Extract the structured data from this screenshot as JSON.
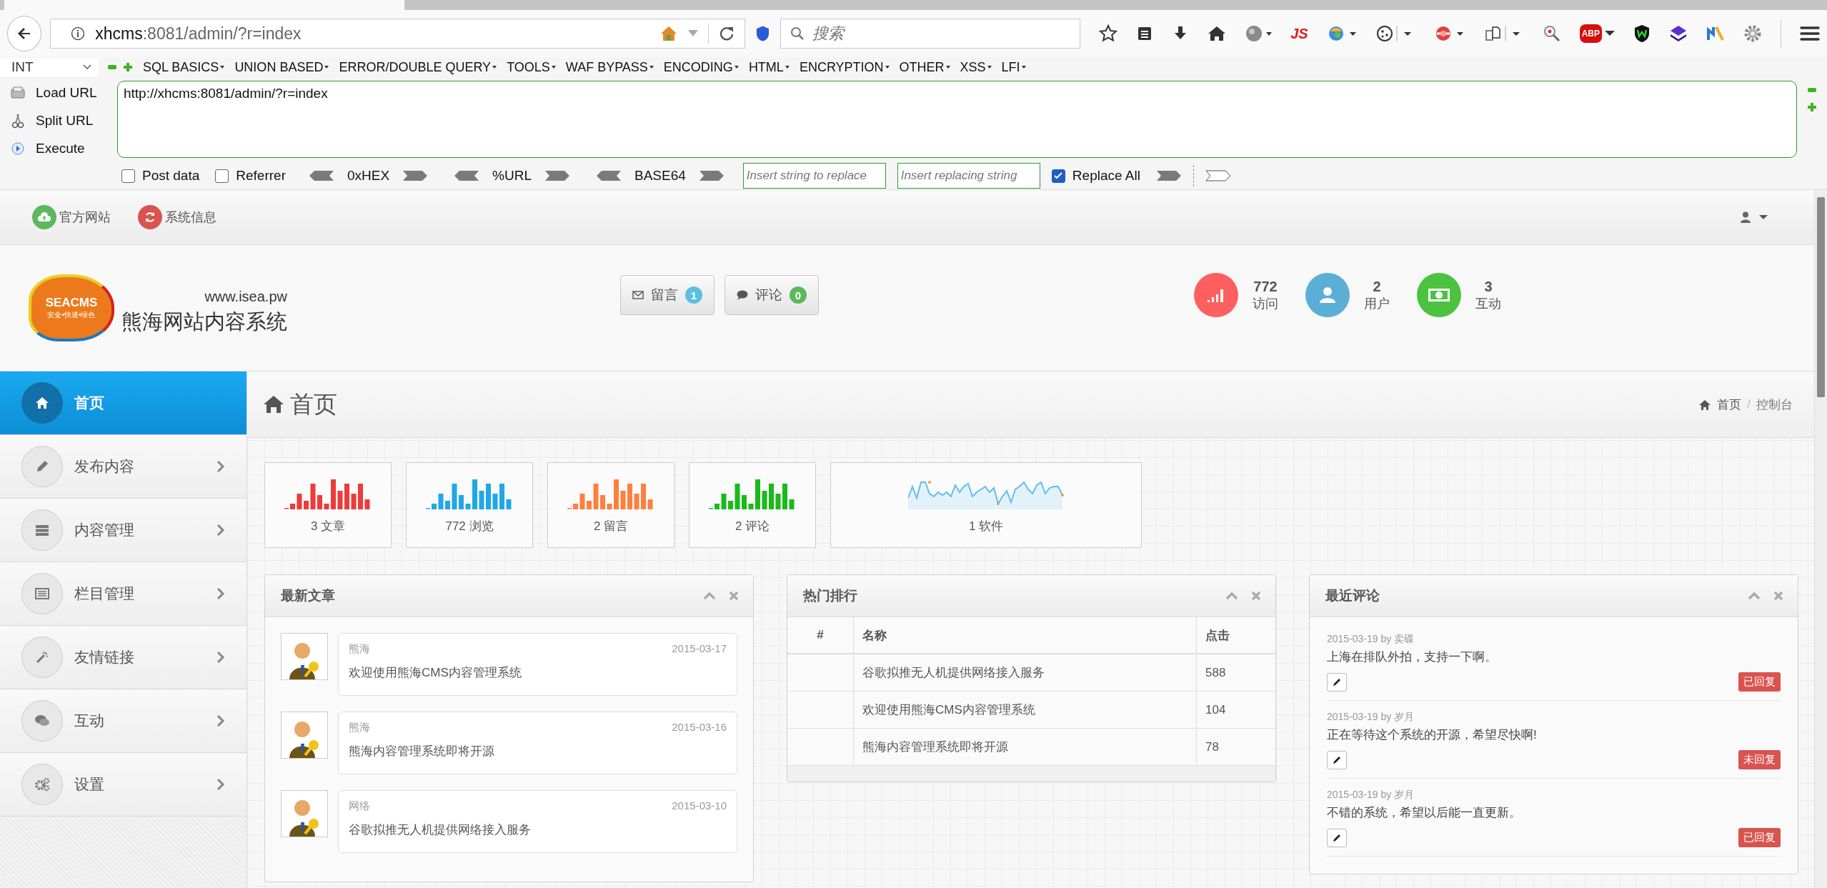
{
  "browser": {
    "url_host": "xhcms",
    "url_path": ":8081/admin/?r=index",
    "search_placeholder": "搜索",
    "js_label": "JS",
    "abp_label": "ABP"
  },
  "hackbar": {
    "encoding": "INT",
    "menus": [
      "SQL BASICS",
      "UNION BASED",
      "ERROR/DOUBLE QUERY",
      "TOOLS",
      "WAF BYPASS",
      "ENCODING",
      "HTML",
      "ENCRYPTION",
      "OTHER",
      "XSS",
      "LFI"
    ],
    "actions": [
      {
        "label": "Load URL",
        "kind": "load"
      },
      {
        "label": "Split URL",
        "kind": "split"
      },
      {
        "label": "Execute",
        "kind": "execute"
      }
    ],
    "url_value": "http://xhcms:8081/admin/?r=index",
    "post_data": {
      "label": "Post data",
      "checked": false
    },
    "referrer": {
      "label": "Referrer",
      "checked": false
    },
    "encoders": [
      "0xHEX",
      "%URL",
      "BASE64"
    ],
    "replace_from": {
      "placeholder": "Insert string to replace"
    },
    "replace_to": {
      "placeholder": "Insert replacing string"
    },
    "replace_all": {
      "label": "Replace All",
      "checked": true
    }
  },
  "topbar": {
    "links": [
      {
        "label": "官方网站",
        "kind": "cloud",
        "color": "#5cb85c"
      },
      {
        "label": "系统信息",
        "kind": "refresh",
        "color": "#d9534f"
      }
    ]
  },
  "header": {
    "logo_text": "SEACMS",
    "logo_tagline": "安全•快速•绿色",
    "site_url": "www.isea.pw",
    "site_name": "熊海网站内容系统",
    "buttons": [
      {
        "label": "留言",
        "kind": "mail",
        "count": "1",
        "color": "#5bc0de"
      },
      {
        "label": "评论",
        "kind": "comment",
        "count": "0",
        "color": "#5cb85c"
      }
    ],
    "stats": [
      {
        "value": "772",
        "label": "访问",
        "kind": "signal",
        "color": "#ff5f5f"
      },
      {
        "value": "2",
        "label": "用户",
        "kind": "user",
        "color": "#5bafd7"
      },
      {
        "value": "3",
        "label": "互动",
        "kind": "money",
        "color": "#4cc241"
      }
    ]
  },
  "sidebar": {
    "items": [
      {
        "label": "首页",
        "kind": "home",
        "selected": true,
        "expandable": false
      },
      {
        "label": "发布内容",
        "kind": "pencil",
        "selected": false,
        "expandable": true
      },
      {
        "label": "内容管理",
        "kind": "list",
        "selected": false,
        "expandable": true
      },
      {
        "label": "栏目管理",
        "kind": "table",
        "selected": false,
        "expandable": true
      },
      {
        "label": "友情链接",
        "kind": "wand",
        "selected": false,
        "expandable": true
      },
      {
        "label": "互动",
        "kind": "comments",
        "selected": false,
        "expandable": true
      },
      {
        "label": "设置",
        "kind": "gears",
        "selected": false,
        "expandable": true
      }
    ]
  },
  "page": {
    "title": "首页",
    "breadcrumb": [
      "首页",
      "控制台"
    ],
    "breadcrumb_separator": "/"
  },
  "mini_stats": [
    {
      "label": "3 文章",
      "kind": "bars",
      "color": "#ef3a3a"
    },
    {
      "label": "772 浏览",
      "kind": "bars",
      "color": "#1fa8e8"
    },
    {
      "label": "2 留言",
      "kind": "bars",
      "color": "#ff7f3f"
    },
    {
      "label": "2 评论",
      "kind": "bars",
      "color": "#1bba1b"
    },
    {
      "label": "1 软件",
      "kind": "line",
      "color": "#5bc0ee"
    }
  ],
  "latest_articles": {
    "title": "最新文章",
    "items": [
      {
        "category": "熊海",
        "date": "2015-03-17",
        "title": "欢迎使用熊海CMS内容管理系统"
      },
      {
        "category": "熊海",
        "date": "2015-03-16",
        "title": "熊海内容管理系统即将开源"
      },
      {
        "category": "网络",
        "date": "2015-03-10",
        "title": "谷歌拟推无人机提供网络接入服务"
      }
    ]
  },
  "hot_ranking": {
    "title": "热门排行",
    "columns": [
      "#",
      "名称",
      "点击"
    ],
    "rows": [
      {
        "name": "谷歌拟推无人机提供网络接入服务",
        "clicks": "588"
      },
      {
        "name": "欢迎使用熊海CMS内容管理系统",
        "clicks": "104"
      },
      {
        "name": "熊海内容管理系统即将开源",
        "clicks": "78"
      }
    ]
  },
  "recent_comments": {
    "title": "最近评论",
    "items": [
      {
        "meta": "2015-03-19 by 卖碟",
        "text": "上海在排队外拍，支持一下啊。",
        "status": "已回复"
      },
      {
        "meta": "2015-03-19 by 岁月",
        "text": "正在等待这个系统的开源，希望尽快啊!",
        "status": "未回复"
      },
      {
        "meta": "2015-03-19 by 岁月",
        "text": "不错的系统，希望以后能一直更新。",
        "status": "已回复"
      }
    ]
  }
}
